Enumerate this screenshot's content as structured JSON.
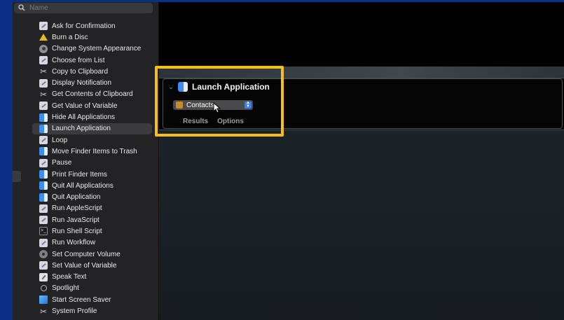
{
  "search": {
    "placeholder": "Name"
  },
  "actions": [
    {
      "label": "Ask for Confirmation",
      "icon": "automator-icon"
    },
    {
      "label": "Burn a Disc",
      "icon": "burn-icon"
    },
    {
      "label": "Change System Appearance",
      "icon": "gear-icon"
    },
    {
      "label": "Choose from List",
      "icon": "automator-icon"
    },
    {
      "label": "Copy to Clipboard",
      "icon": "scissors-icon"
    },
    {
      "label": "Display Notification",
      "icon": "automator-icon"
    },
    {
      "label": "Get Contents of Clipboard",
      "icon": "scissors-icon"
    },
    {
      "label": "Get Value of Variable",
      "icon": "automator-icon"
    },
    {
      "label": "Hide All Applications",
      "icon": "finder-icon"
    },
    {
      "label": "Launch Application",
      "icon": "finder-icon",
      "selected": true
    },
    {
      "label": "Loop",
      "icon": "automator-icon"
    },
    {
      "label": "Move Finder Items to Trash",
      "icon": "finder-icon"
    },
    {
      "label": "Pause",
      "icon": "automator-icon"
    },
    {
      "label": "Print Finder Items",
      "icon": "finder-icon"
    },
    {
      "label": "Quit All Applications",
      "icon": "finder-icon"
    },
    {
      "label": "Quit Application",
      "icon": "finder-icon"
    },
    {
      "label": "Run AppleScript",
      "icon": "automator-icon"
    },
    {
      "label": "Run JavaScript",
      "icon": "automator-icon"
    },
    {
      "label": "Run Shell Script",
      "icon": "terminal-icon"
    },
    {
      "label": "Run Workflow",
      "icon": "automator-icon"
    },
    {
      "label": "Set Computer Volume",
      "icon": "volume-icon"
    },
    {
      "label": "Set Value of Variable",
      "icon": "automator-icon"
    },
    {
      "label": "Speak Text",
      "icon": "speak-icon"
    },
    {
      "label": "Spotlight",
      "icon": "spotlight-icon"
    },
    {
      "label": "Start Screen Saver",
      "icon": "screensaver-icon"
    },
    {
      "label": "System Profile",
      "icon": "scissors-icon"
    }
  ],
  "action_card": {
    "title": "Launch Application",
    "application": "Contacts",
    "tabs": [
      "Results",
      "Options"
    ]
  },
  "colors": {
    "frame": "#0c2f86",
    "highlight": "#f5bf17",
    "sidebar": "#232325",
    "selection": "#3b3b3e"
  }
}
